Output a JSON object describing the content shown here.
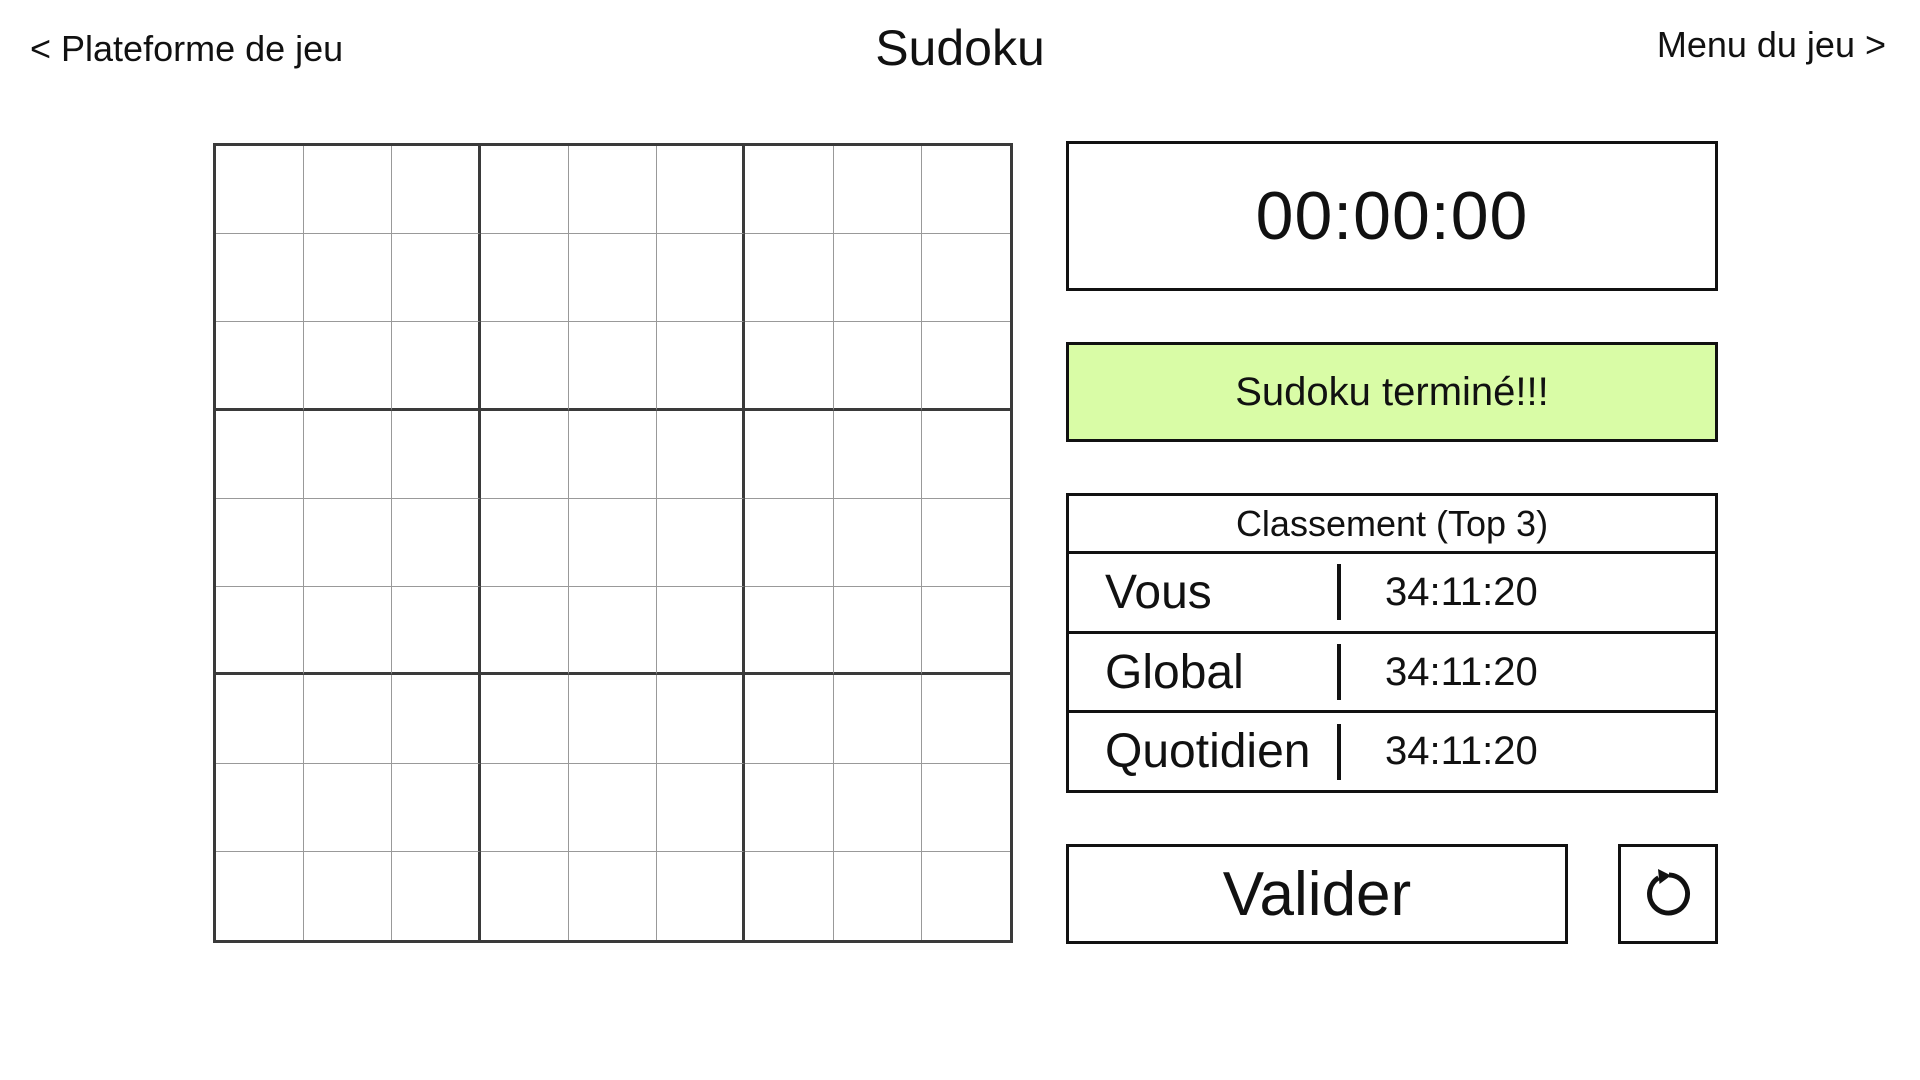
{
  "header": {
    "back_link": "< Plateforme de jeu",
    "title": "Sudoku",
    "menu_link": "Menu du jeu >"
  },
  "board": {
    "size": 9,
    "cells": [
      [
        "",
        "",
        "",
        "",
        "",
        "",
        "",
        "",
        ""
      ],
      [
        "",
        "",
        "",
        "",
        "",
        "",
        "",
        "",
        ""
      ],
      [
        "",
        "",
        "",
        "",
        "",
        "",
        "",
        "",
        ""
      ],
      [
        "",
        "",
        "",
        "",
        "",
        "",
        "",
        "",
        ""
      ],
      [
        "",
        "",
        "",
        "",
        "",
        "",
        "",
        "",
        ""
      ],
      [
        "",
        "",
        "",
        "",
        "",
        "",
        "",
        "",
        ""
      ],
      [
        "",
        "",
        "",
        "",
        "",
        "",
        "",
        "",
        ""
      ],
      [
        "",
        "",
        "",
        "",
        "",
        "",
        "",
        "",
        ""
      ],
      [
        "",
        "",
        "",
        "",
        "",
        "",
        "",
        "",
        ""
      ]
    ]
  },
  "timer": {
    "value": "00:00:00"
  },
  "status": {
    "message": "Sudoku terminé!!!",
    "color": "#d9fca6"
  },
  "leaderboard": {
    "title": "Classement (Top 3)",
    "rows": [
      {
        "label": "Vous",
        "time": "34:11:20"
      },
      {
        "label": "Global",
        "time": "34:11:20"
      },
      {
        "label": "Quotidien",
        "time": "34:11:20"
      }
    ]
  },
  "actions": {
    "validate_label": "Valider",
    "reset_icon": "refresh-icon"
  }
}
